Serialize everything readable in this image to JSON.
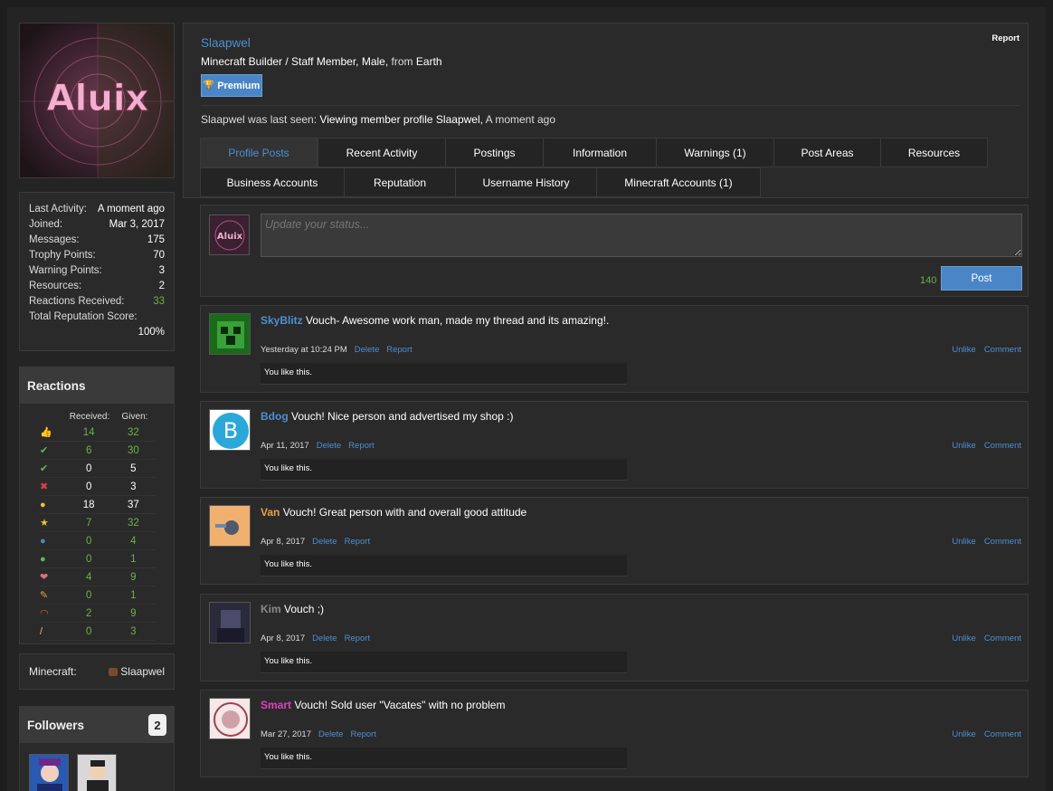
{
  "profile": {
    "username": "Slaapwel",
    "report_label": "Report",
    "title": "Minecraft Builder / Staff Member, Male,",
    "from_word": "from",
    "location": "Earth",
    "premium_label": "Premium",
    "last_seen_prefix": "Slaapwel was last seen:",
    "last_seen_activity": "Viewing member profile Slaapwel,",
    "last_seen_time": "A moment ago",
    "avatar_text": "Aluix"
  },
  "stats": [
    {
      "label": "Last Activity:",
      "value": "A moment ago"
    },
    {
      "label": "Joined:",
      "value": "Mar 3, 2017"
    },
    {
      "label": "Messages:",
      "value": "175"
    },
    {
      "label": "Trophy Points:",
      "value": "70"
    },
    {
      "label": "Warning Points:",
      "value": "3"
    },
    {
      "label": "Resources:",
      "value": "2"
    },
    {
      "label": "Reactions Received:",
      "value": "33"
    },
    {
      "label": "Total Reputation Score:",
      "value": "100%"
    }
  ],
  "reactions": {
    "title": "Reactions",
    "received_label": "Received:",
    "given_label": "Given:",
    "rows": [
      {
        "icon": "thumbs-up-icon",
        "glyph": "👍",
        "color": "#e8a04a",
        "received": "14",
        "given": "32",
        "green": true
      },
      {
        "icon": "check-icon",
        "glyph": "✔",
        "color": "#5cb85c",
        "received": "6",
        "given": "30",
        "green": true
      },
      {
        "icon": "check-icon",
        "glyph": "✔",
        "color": "#5cb85c",
        "received": "0",
        "given": "5",
        "green": false
      },
      {
        "icon": "cross-icon",
        "glyph": "✖",
        "color": "#e04040",
        "received": "0",
        "given": "3",
        "green": false
      },
      {
        "icon": "smile-icon",
        "glyph": "●",
        "color": "#f0c030",
        "received": "18",
        "given": "37",
        "green": false
      },
      {
        "icon": "star-icon",
        "glyph": "★",
        "color": "#f0c030",
        "received": "7",
        "given": "32",
        "green": true
      },
      {
        "icon": "info-icon",
        "glyph": "●",
        "color": "#4a86c5",
        "received": "0",
        "given": "4",
        "green": true
      },
      {
        "icon": "info-green-icon",
        "glyph": "●",
        "color": "#5cb85c",
        "received": "0",
        "given": "1",
        "green": true
      },
      {
        "icon": "heart-icon",
        "glyph": "❤",
        "color": "#e07080",
        "received": "4",
        "given": "9",
        "green": true
      },
      {
        "icon": "wrench-icon",
        "glyph": "✎",
        "color": "#e8a04a",
        "received": "0",
        "given": "1",
        "green": true
      },
      {
        "icon": "rainbow-icon",
        "glyph": "◠",
        "color": "#e05050",
        "received": "2",
        "given": "9",
        "green": true
      },
      {
        "icon": "brush-icon",
        "glyph": "/",
        "color": "#e8c070",
        "received": "0",
        "given": "3",
        "green": true
      }
    ]
  },
  "minecraft": {
    "label": "Minecraft:",
    "value": "Slaapwel"
  },
  "followers": {
    "title": "Followers",
    "count": "2"
  },
  "tabs": [
    "Profile Posts",
    "Recent Activity",
    "Postings",
    "Information",
    "Warnings (1)",
    "Post Areas",
    "Resources",
    "Business Accounts",
    "Reputation",
    "Username History",
    "Minecraft Accounts (1)"
  ],
  "status": {
    "placeholder": "Update your status...",
    "counter": "140",
    "post_label": "Post"
  },
  "posts": [
    {
      "author": "SkyBlitz",
      "author_color": "#4d8fd1",
      "text": "Vouch- Awesome work man, made my thread and its amazing!.",
      "time": "Yesterday at 10:24 PM",
      "delete": "Delete",
      "report": "Report",
      "unlike": "Unlike",
      "comment": "Comment",
      "likes": "You like this."
    },
    {
      "author": "Bdog",
      "author_color": "#4d8fd1",
      "text": "Vouch! Nice person and advertised my shop :)",
      "time": "Apr 11, 2017",
      "delete": "Delete",
      "report": "Report",
      "unlike": "Unlike",
      "comment": "Comment",
      "likes": "You like this."
    },
    {
      "author": "Van",
      "author_color": "#e8a04a",
      "text": "Vouch! Great person with and overall good attitude",
      "time": "Apr 8, 2017",
      "delete": "Delete",
      "report": "Report",
      "unlike": "Unlike",
      "comment": "Comment",
      "likes": "You like this."
    },
    {
      "author": "Kim",
      "author_color": "#8a8a8a",
      "text": "Vouch ;)",
      "time": "Apr 8, 2017",
      "delete": "Delete",
      "report": "Report",
      "unlike": "Unlike",
      "comment": "Comment",
      "likes": "You like this."
    },
    {
      "author": "Smart",
      "author_color": "#e040c0",
      "text": "Vouch! Sold user \"Vacates\" with no problem",
      "time": "Mar 27, 2017",
      "delete": "Delete",
      "report": "Report",
      "unlike": "Unlike",
      "comment": "Comment",
      "likes": "You like this."
    }
  ]
}
